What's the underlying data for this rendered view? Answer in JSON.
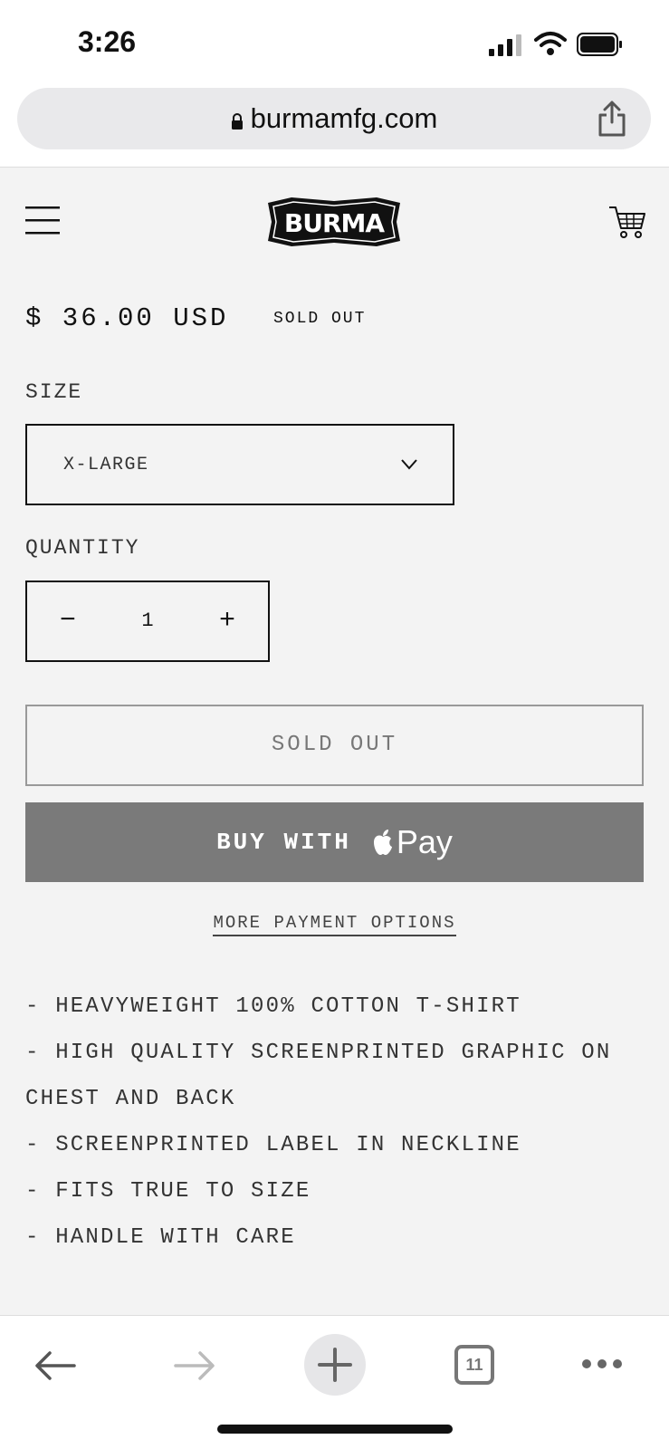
{
  "status_bar": {
    "time": "3:26"
  },
  "browser": {
    "url": "burmamfg.com",
    "tab_count": "11"
  },
  "site": {
    "logo_text": "BURMA"
  },
  "product": {
    "price": "$ 36.00 USD",
    "badge": "SOLD OUT",
    "size_label": "SIZE",
    "size_value": "X-LARGE",
    "quantity_label": "QUANTITY",
    "quantity_minus": "−",
    "quantity_value": "1",
    "quantity_plus": "+",
    "soldout_button": "SOLD OUT",
    "applepay_prefix": "BUY WITH",
    "applepay_suffix": "Pay",
    "more_payment": "MORE PAYMENT OPTIONS",
    "description": [
      "- HEAVYWEIGHT 100% COTTON T-SHIRT",
      "- HIGH QUALITY SCREENPRINTED GRAPHIC ON CHEST AND BACK",
      "- SCREENPRINTED LABEL IN NECKLINE",
      "- FITS TRUE TO SIZE",
      "- HANDLE WITH CARE"
    ]
  },
  "colors": {
    "applepay_bg": "#7a7a7a",
    "page_bg": "#f3f3f3"
  }
}
